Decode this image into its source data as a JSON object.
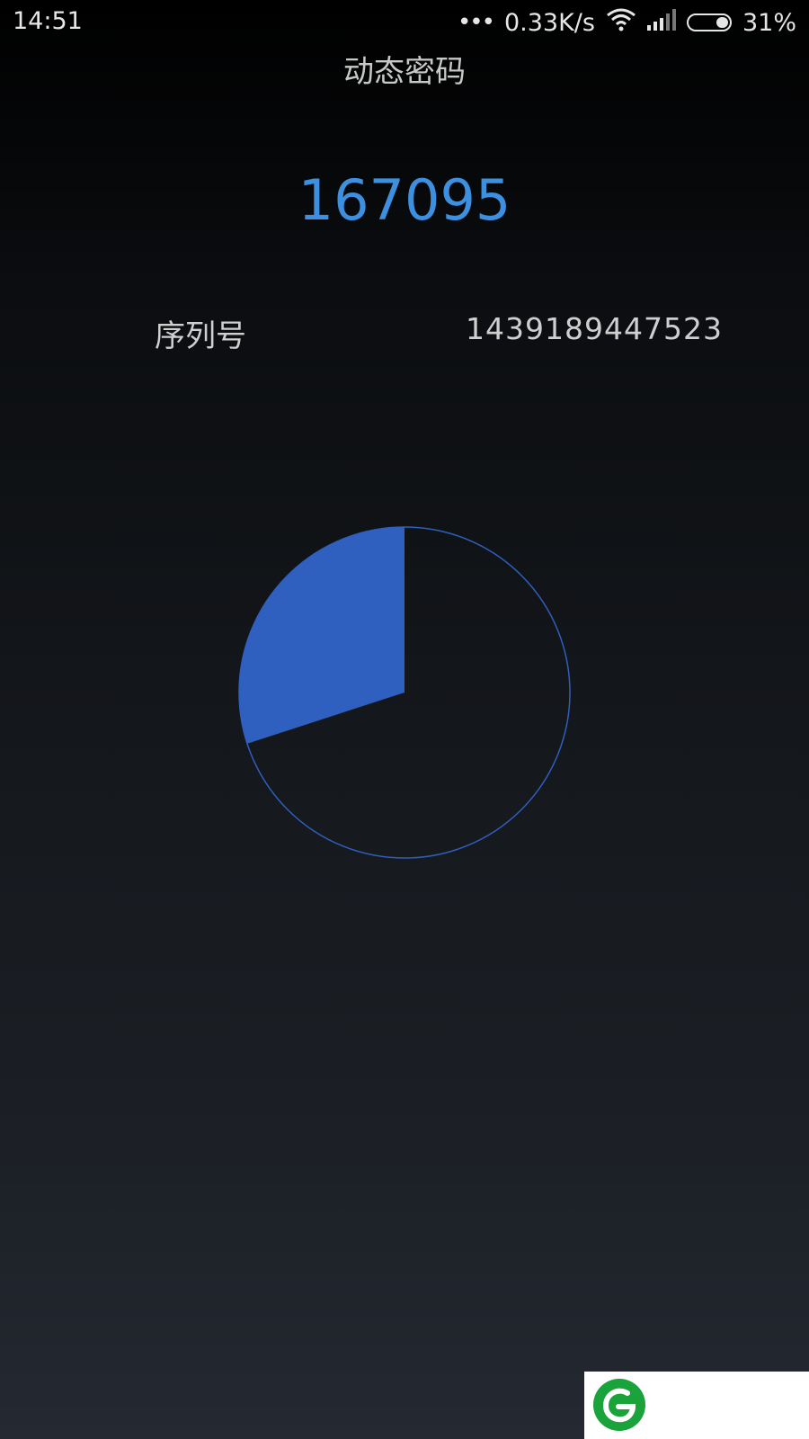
{
  "status_bar": {
    "time": "14:51",
    "net_speed": "0.33K/s",
    "battery_percent_label": "31%",
    "battery_level": 0.31,
    "icons": [
      "more-dots-icon",
      "wifi-icon",
      "signal-icon",
      "battery-icon"
    ]
  },
  "header": {
    "title": "动态密码"
  },
  "otp": {
    "code": "167095"
  },
  "serial": {
    "label": "序列号",
    "value": "1439189447523"
  },
  "countdown": {
    "fraction_remaining": 0.3
  },
  "colors": {
    "accent": "#3d8fe0",
    "pie_fill": "#2f5fbf",
    "pie_outline": "#2f5fbf",
    "logo_green": "#1aa23b"
  },
  "logo": {
    "icon": "app-logo-icon"
  }
}
